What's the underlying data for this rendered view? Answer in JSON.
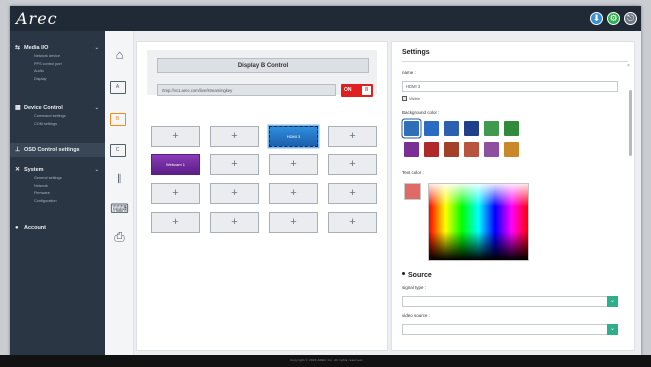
{
  "app": {
    "logo_text": "Arec"
  },
  "topbar": {
    "icons": [
      {
        "name": "download-icon",
        "glyph": "⬇",
        "color": "#3a8fd9"
      },
      {
        "name": "settings-gear-icon",
        "glyph": "⚙",
        "color": "#2fae4f"
      },
      {
        "name": "logout-icon",
        "glyph": "⎋",
        "color": "#6e7781"
      }
    ]
  },
  "sidebar": {
    "media_io": {
      "label": "Media I/O",
      "items": [
        "Network device",
        "PPS control port",
        "Audio",
        "Display"
      ]
    },
    "device_control": {
      "label": "Device Control",
      "items": [
        "Command settings",
        "COM settings"
      ]
    },
    "osd": {
      "label": "OSD Control settings"
    },
    "system": {
      "label": "System",
      "items": [
        "General settings",
        "Network",
        "Firmware",
        "Configuration"
      ]
    },
    "account": {
      "label": "Account"
    }
  },
  "tools": [
    {
      "name": "home-icon",
      "glyph": "⌂"
    },
    {
      "name": "display-a-icon",
      "glyph": "A"
    },
    {
      "name": "display-b-icon",
      "glyph": "B"
    },
    {
      "name": "display-c-icon",
      "glyph": "C"
    },
    {
      "name": "audio-mixer-icon",
      "glyph": "𝄃"
    },
    {
      "name": "keyboard-icon",
      "glyph": "⌨"
    },
    {
      "name": "camera-icon",
      "glyph": "⎙"
    }
  ],
  "display": {
    "title": "Display B Control",
    "url": "rtmp://vc1.arec.com/live/streamingkey",
    "toggle_label": "ON",
    "tiles": [
      [
        "+",
        "+",
        "HDMI 3",
        "+"
      ],
      [
        "Webcam 1",
        "+",
        "+",
        "+"
      ],
      [
        "+",
        "+",
        "+",
        "+"
      ],
      [
        "+",
        "+",
        "+",
        "+"
      ]
    ]
  },
  "settings": {
    "title": "Settings",
    "name_label": "name :",
    "name_value": "HDMI 3",
    "visible_label": "Visible",
    "background_label": "Background color :",
    "background_swatches": [
      [
        "#2e6fb8",
        "#2a6cc4",
        "#2c5fb0",
        "#1f3f8a",
        "#3f9a4e",
        "#2f8a3a"
      ],
      [
        "#7a2f96",
        "#b0282a",
        "#a2402a",
        "#b8543e",
        "#8d4fa0",
        "#c9892a"
      ]
    ],
    "text_color_label": "Text color :",
    "text_color": "#e06a66",
    "source_title": "Source",
    "signal_type_label": "signal type :",
    "video_source_label": "video source :"
  },
  "footer": {
    "text": "Copyright © 2020 AREC Inc. All rights reserved."
  }
}
